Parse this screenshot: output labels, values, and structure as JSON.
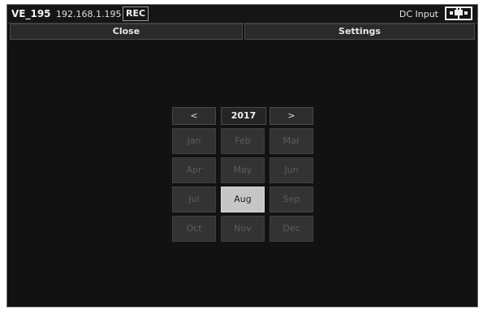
{
  "header": {
    "device_name": "VE_195",
    "ip": "192.168.1.195",
    "rec_badge": "REC",
    "power_label": "DC Input",
    "power_icon": "dc-plug-icon"
  },
  "actions": {
    "close_label": "Close",
    "settings_label": "Settings"
  },
  "calendar": {
    "prev_label": "<",
    "year": "2017",
    "next_label": ">",
    "months": [
      "Jan",
      "Feb",
      "Mar",
      "Apr",
      "May",
      "Jun",
      "Jul",
      "Aug",
      "Sep",
      "Oct",
      "Nov",
      "Dec"
    ],
    "selected_month": "Aug"
  },
  "colors": {
    "background": "#121212",
    "selected_month": "#c6c6c6",
    "disabled_month_text": "#5d5d5d"
  }
}
